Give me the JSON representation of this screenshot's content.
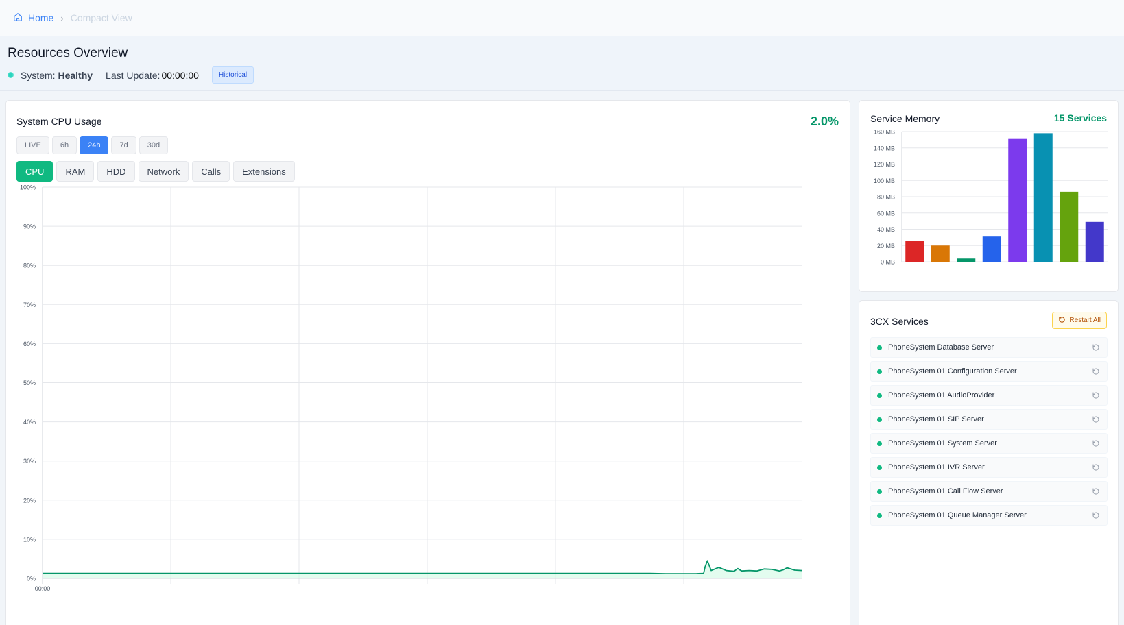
{
  "breadcrumb": {
    "home": "Home",
    "sep": "›",
    "current": "Compact View"
  },
  "header": {
    "title": "Resources Overview",
    "system_label": "System:",
    "system_value": "Healthy",
    "last_update_label": "Last Update:",
    "last_update_value": "00:00:00",
    "mode_badge": "Historical"
  },
  "cpu_card": {
    "title": "System CPU Usage",
    "current_value": "2.0%",
    "ranges": [
      "LIVE",
      "6h",
      "24h",
      "7d",
      "30d"
    ],
    "active_range": "24h",
    "metrics": [
      "CPU",
      "RAM",
      "HDD",
      "Network",
      "Calls",
      "Extensions"
    ],
    "active_metric": "CPU"
  },
  "memory_card": {
    "title": "Service Memory",
    "count_label": "15 Services"
  },
  "services_card": {
    "title": "3CX Services",
    "restart_all": "Restart All",
    "services": [
      "PhoneSystem Database Server",
      "PhoneSystem 01 Configuration Server",
      "PhoneSystem 01 AudioProvider",
      "PhoneSystem 01 SIP Server",
      "PhoneSystem 01 System Server",
      "PhoneSystem 01 IVR Server",
      "PhoneSystem 01 Call Flow Server",
      "PhoneSystem 01 Queue Manager Server"
    ],
    "status_color": "#10b981"
  },
  "colors": {
    "accent": "#3b82f6",
    "success": "#10b981",
    "line": "#059669"
  },
  "chart_data": [
    {
      "type": "line",
      "title": "System CPU Usage",
      "ylabel": "",
      "xlabel": "",
      "ylim": [
        0,
        100
      ],
      "y_ticks": [
        "0%",
        "10%",
        "20%",
        "30%",
        "40%",
        "50%",
        "60%",
        "70%",
        "80%",
        "90%",
        "100%"
      ],
      "x_tick_labels": [
        "00:00"
      ],
      "grid": true,
      "series": [
        {
          "name": "",
          "x": [
            0,
            0.05,
            0.1,
            0.15,
            0.2,
            0.25,
            0.3,
            0.35,
            0.4,
            0.45,
            0.5,
            0.55,
            0.6,
            0.65,
            0.7,
            0.75,
            0.8,
            0.82,
            0.84,
            0.86,
            0.87,
            0.872,
            0.875,
            0.88,
            0.89,
            0.9,
            0.91,
            0.915,
            0.92,
            0.93,
            0.94,
            0.95,
            0.96,
            0.97,
            0.975,
            0.98,
            0.99,
            1.0
          ],
          "y": [
            1.3,
            1.3,
            1.3,
            1.3,
            1.3,
            1.3,
            1.3,
            1.3,
            1.3,
            1.3,
            1.3,
            1.3,
            1.3,
            1.3,
            1.3,
            1.3,
            1.3,
            1.2,
            1.2,
            1.2,
            1.3,
            3.0,
            4.5,
            2.0,
            2.8,
            2.0,
            1.8,
            2.5,
            1.9,
            2.0,
            1.9,
            2.4,
            2.3,
            1.9,
            2.2,
            2.7,
            2.1,
            2.0
          ]
        }
      ]
    },
    {
      "type": "bar",
      "title": "Service Memory",
      "ylim": [
        0,
        160
      ],
      "y_ticks": [
        "0 MB",
        "20 MB",
        "40 MB",
        "60 MB",
        "80 MB",
        "100 MB",
        "120 MB",
        "140 MB",
        "160 MB"
      ],
      "grid": true,
      "values": [
        26,
        20,
        4,
        31,
        151,
        158,
        86,
        49
      ],
      "colors": [
        "#dc2626",
        "#d97706",
        "#059669",
        "#2563eb",
        "#7c3aed",
        "#0891b2",
        "#65a30d",
        "#4338ca"
      ]
    }
  ]
}
